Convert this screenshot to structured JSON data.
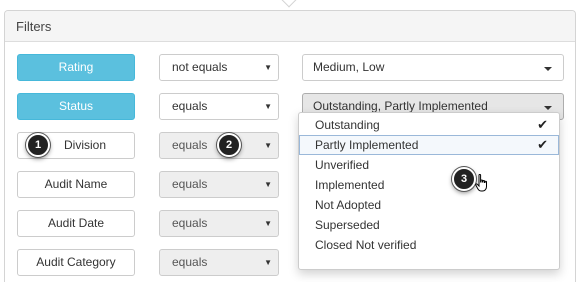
{
  "panel": {
    "title": "Filters"
  },
  "rows": [
    {
      "field": "Rating",
      "operator": "not equals",
      "value": "Medium, Low"
    },
    {
      "field": "Status",
      "operator": "equals",
      "value": "Outstanding, Partly Implemented"
    },
    {
      "field": "Division",
      "operator": "equals"
    },
    {
      "field": "Audit Name",
      "operator": "equals"
    },
    {
      "field": "Audit Date",
      "operator": "equals"
    },
    {
      "field": "Audit Category",
      "operator": "equals"
    }
  ],
  "status_dropdown": {
    "options": [
      {
        "label": "Outstanding",
        "checked": true
      },
      {
        "label": "Partly Implemented",
        "checked": true
      },
      {
        "label": "Unverified",
        "checked": false
      },
      {
        "label": "Implemented",
        "checked": false
      },
      {
        "label": "Not Adopted",
        "checked": false
      },
      {
        "label": "Superseded",
        "checked": false
      },
      {
        "label": "Closed Not verified",
        "checked": false
      }
    ],
    "check_glyph": "✔"
  },
  "steps": [
    "1",
    "2",
    "3"
  ],
  "colors": {
    "accent": "#5bc0de",
    "accent_border": "#46b8da",
    "step_badge": "#222222"
  }
}
